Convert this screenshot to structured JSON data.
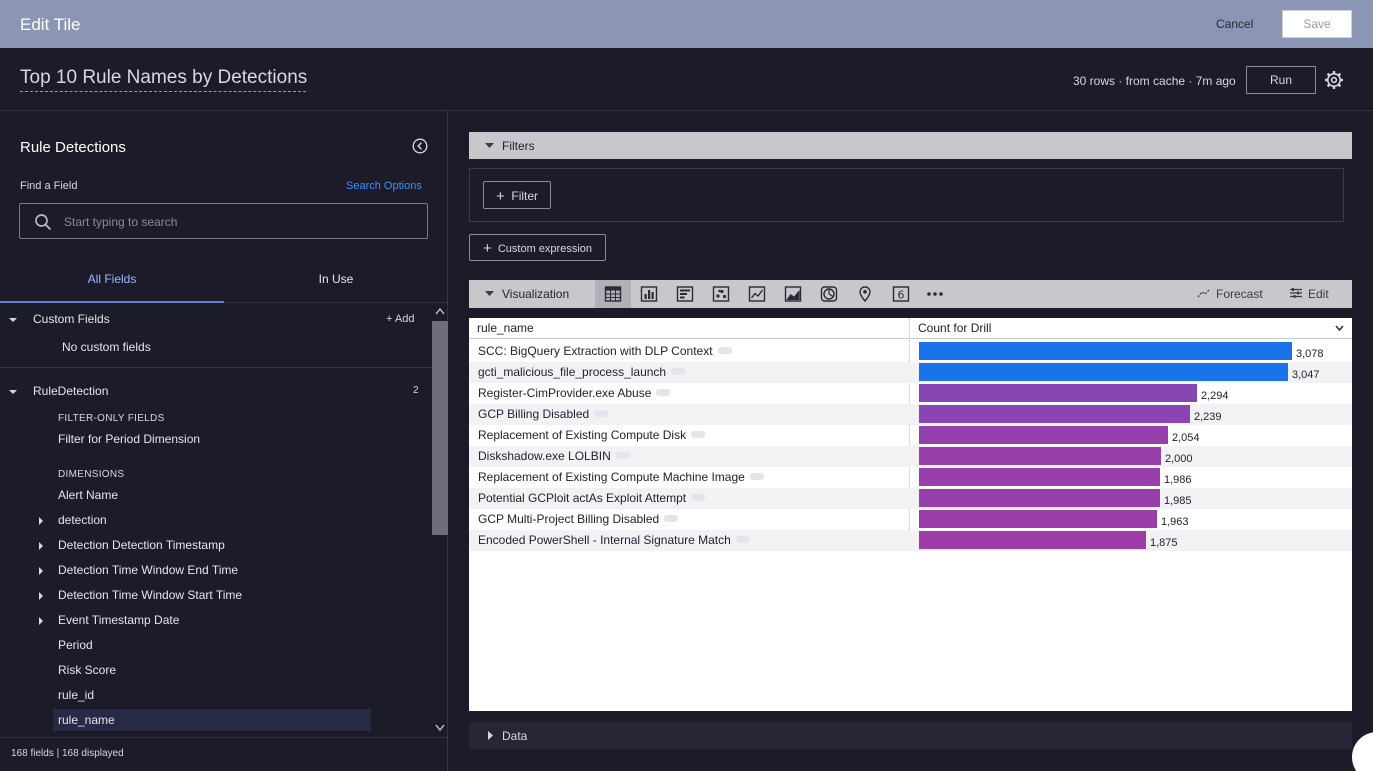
{
  "topbar": {
    "title": "Edit Tile",
    "cancel_label": "Cancel",
    "save_label": "Save"
  },
  "header": {
    "tile_title": "Top 10 Rule Names by Detections",
    "cache_info": "30 rows · from cache · 7m ago",
    "run_label": "Run"
  },
  "left_panel": {
    "title": "Rule Detections",
    "find_label": "Find a Field",
    "search_options": "Search Options",
    "search_placeholder": "Start typing to search",
    "tabs": [
      "All Fields",
      "In Use"
    ],
    "custom_fields": {
      "label": "Custom Fields",
      "add_label": "Add",
      "empty": "No custom fields"
    },
    "explore": {
      "label": "RuleDetection",
      "count": "2"
    },
    "filter_only_header": "FILTER-ONLY FIELDS",
    "filter_only_fields": [
      "Filter for Period Dimension"
    ],
    "dimensions_header": "DIMENSIONS",
    "dimensions": [
      {
        "label": "Alert Name",
        "expandable": false
      },
      {
        "label": "detection",
        "expandable": true
      },
      {
        "label": "Detection Detection Timestamp",
        "expandable": true
      },
      {
        "label": "Detection Time Window End Time",
        "expandable": true
      },
      {
        "label": "Detection Time Window Start Time",
        "expandable": true
      },
      {
        "label": "Event Timestamp Date",
        "expandable": true
      },
      {
        "label": "Period",
        "expandable": false
      },
      {
        "label": "Risk Score",
        "expandable": false
      },
      {
        "label": "rule_id",
        "expandable": false
      },
      {
        "label": "rule_name",
        "expandable": false,
        "selected": true
      }
    ],
    "footer": "168 fields | 168 displayed"
  },
  "filters": {
    "label": "Filters",
    "filter_button": "Filter",
    "custom_expression_button": "Custom expression"
  },
  "visualization": {
    "label": "Visualization",
    "icons": [
      "table-icon",
      "column-chart-icon",
      "bar-chart-icon",
      "scatter-icon",
      "line-chart-icon",
      "area-chart-icon",
      "pie-chart-icon",
      "map-pin-icon",
      "single-value-icon",
      "more-icon"
    ],
    "forecast_label": "Forecast",
    "edit_label": "Edit"
  },
  "table_headers": {
    "dimension": "rule_name",
    "measure": "Count for Drill"
  },
  "colors": {
    "bar_start": "#1a73e8",
    "bar_end": "#a03ca8"
  },
  "chart_data": {
    "type": "bar",
    "categories": [
      "SCC: BigQuery Extraction with DLP Context",
      "gcti_malicious_file_process_launch",
      "Register-CimProvider.exe Abuse",
      "GCP Billing Disabled",
      "Replacement of Existing Compute Disk",
      "Diskshadow.exe LOLBIN",
      "Replacement of Existing Compute Machine Image",
      "Potential GCPloit actAs Exploit Attempt",
      "GCP Multi-Project Billing Disabled",
      "Encoded PowerShell - Internal Signature Match"
    ],
    "values": [
      3078,
      3047,
      2294,
      2239,
      2054,
      2000,
      1986,
      1985,
      1963,
      1875
    ],
    "value_labels": [
      "3,078",
      "3,047",
      "2,294",
      "2,239",
      "2,054",
      "2,000",
      "1,986",
      "1,985",
      "1,963",
      "1,875"
    ],
    "xlabel": "rule_name",
    "ylabel": "Count for Drill",
    "ylim": [
      0,
      3078
    ],
    "legend": "none"
  },
  "data_section": {
    "label": "Data"
  }
}
